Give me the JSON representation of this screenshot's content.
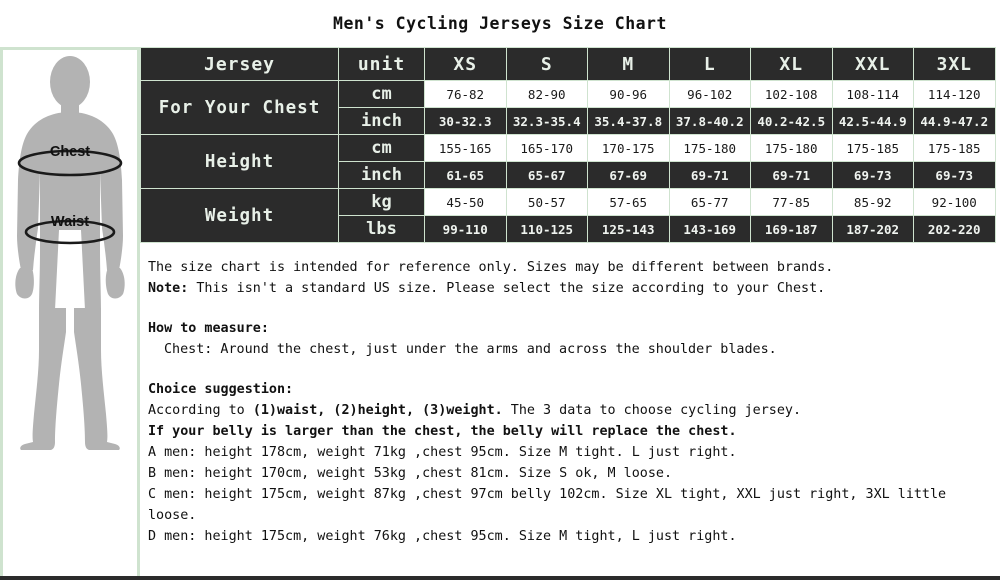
{
  "title": "Men's Cycling Jerseys Size Chart",
  "figure": {
    "chest_label": "Chest",
    "waist_label": "Waist",
    "body_icon": "male-body-silhouette-icon",
    "body_color": "#b3b3b3"
  },
  "colors": {
    "cell_dark": "#2b2b2b",
    "cell_light": "#ffffff",
    "border_green": "#cfe3cf",
    "text_light": "#e8f0e8",
    "text_dark": "#1a1a1a"
  },
  "table": {
    "header": [
      "Jersey",
      "unit",
      "XS",
      "S",
      "M",
      "L",
      "XL",
      "XXL",
      "3XL"
    ],
    "sizes": [
      "XS",
      "S",
      "M",
      "L",
      "XL",
      "XXL",
      "3XL"
    ],
    "groups": [
      {
        "label": "For Your Chest",
        "rows": [
          {
            "unit": "cm",
            "style": "light",
            "values": [
              "76-82",
              "82-90",
              "90-96",
              "96-102",
              "102-108",
              "108-114",
              "114-120"
            ]
          },
          {
            "unit": "inch",
            "style": "dark",
            "values": [
              "30-32.3",
              "32.3-35.4",
              "35.4-37.8",
              "37.8-40.2",
              "40.2-42.5",
              "42.5-44.9",
              "44.9-47.2"
            ]
          }
        ]
      },
      {
        "label": "Height",
        "rows": [
          {
            "unit": "cm",
            "style": "light",
            "values": [
              "155-165",
              "165-170",
              "170-175",
              "175-180",
              "175-180",
              "175-185",
              "175-185"
            ]
          },
          {
            "unit": "inch",
            "style": "dark",
            "values": [
              "61-65",
              "65-67",
              "67-69",
              "69-71",
              "69-71",
              "69-73",
              "69-73"
            ]
          }
        ]
      },
      {
        "label": "Weight",
        "rows": [
          {
            "unit": "kg",
            "style": "light",
            "values": [
              "45-50",
              "50-57",
              "57-65",
              "65-77",
              "77-85",
              "85-92",
              "92-100"
            ]
          },
          {
            "unit": "lbs",
            "style": "dark",
            "values": [
              "99-110",
              "110-125",
              "125-143",
              "143-169",
              "169-187",
              "187-202",
              "202-220"
            ]
          }
        ]
      }
    ]
  },
  "notes": {
    "disclaimer": "The size chart is intended for reference only. Sizes may be different between brands.",
    "note_label": "Note:",
    "note_text": " This isn't a standard US size. Please select the size according to your Chest.",
    "how_to_measure_heading": "How to measure:",
    "how_to_measure_chest": "Chest: Around the chest, just under the arms and across the shoulder blades.",
    "choice_heading": "Choice suggestion:",
    "according_prefix": "According to ",
    "according_bold": "(1)waist, (2)height, (3)weight.",
    "according_suffix": " The 3 data to choose cycling jersey.",
    "belly_line": "If your belly is larger than the chest, the belly will replace the chest.",
    "examples": [
      "A men: height 178cm, weight 71kg ,chest 95cm. Size M tight. L just right.",
      "B men: height 170cm, weight 53kg ,chest 81cm. Size S ok, M loose.",
      "C men: height 175cm, weight 87kg ,chest 97cm belly 102cm. Size XL tight, XXL just right, 3XL little loose.",
      "D men: height 175cm, weight 76kg ,chest 95cm. Size M tight, L just right."
    ]
  }
}
